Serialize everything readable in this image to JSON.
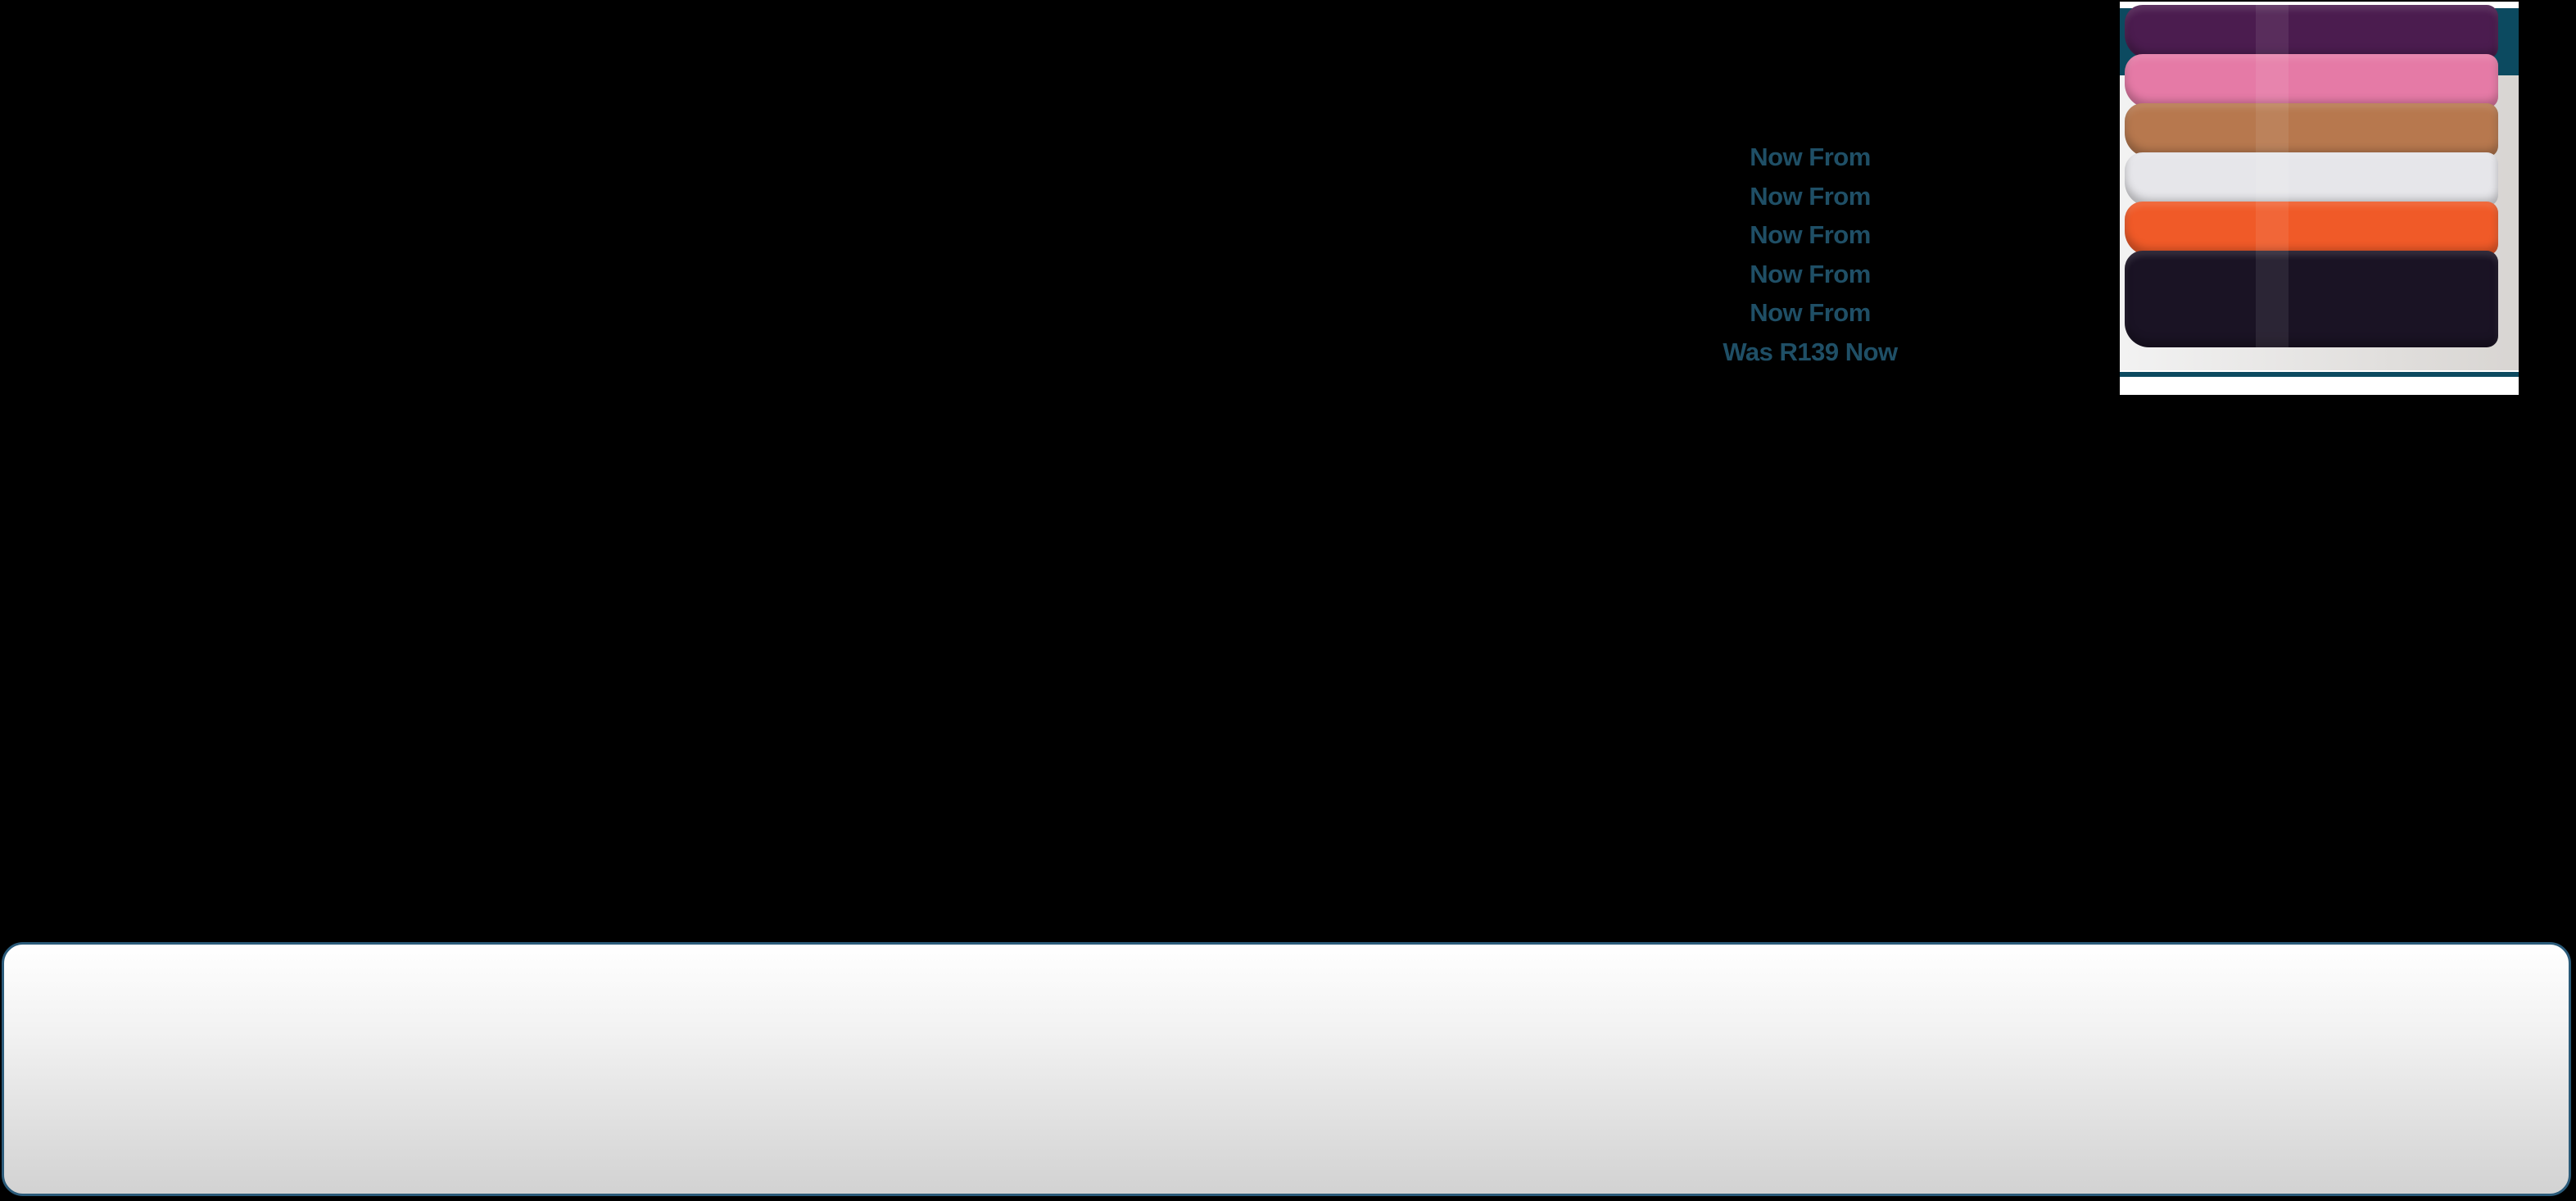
{
  "price_lines": [
    "Now From",
    "Now From",
    "Now From",
    "Now From",
    "Now From",
    "Was R139 Now"
  ],
  "product_image": {
    "towel_colors": [
      "#4b1c4f",
      "#e57aa6",
      "#b7784e",
      "#e6e6ea",
      "#f05a28",
      "#1a1324"
    ]
  },
  "colors": {
    "price_text": "#1f4f66",
    "panel_border": "#2b5b7a",
    "teal_band": "#0c4a60"
  }
}
